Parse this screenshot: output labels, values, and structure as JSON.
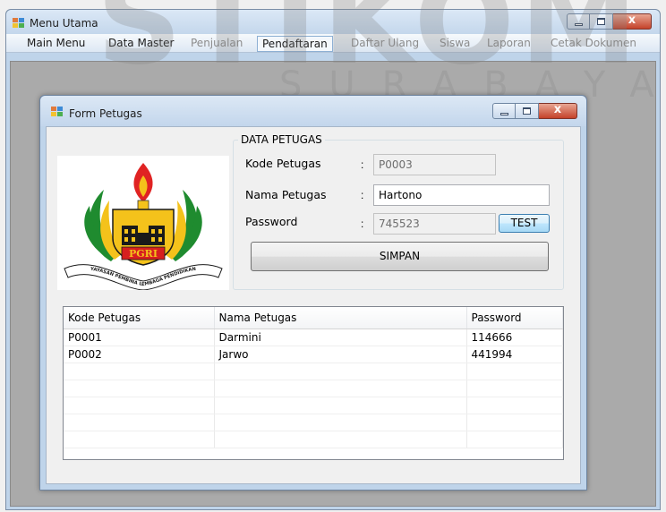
{
  "watermark": {
    "big": "STIKOM",
    "small": "SURABAYA"
  },
  "main_window": {
    "title": "Menu Utama",
    "menu": [
      {
        "label": "Main Menu",
        "state": "normal"
      },
      {
        "label": "Data Master",
        "state": "normal"
      },
      {
        "label": "Penjualan",
        "state": "disabled"
      },
      {
        "label": "Pendaftaran",
        "state": "selected"
      },
      {
        "label": "Daftar Ulang",
        "state": "disabled"
      },
      {
        "label": "Siswa",
        "state": "disabled"
      },
      {
        "label": "Laporan",
        "state": "disabled"
      },
      {
        "label": "Cetak Dokumen",
        "state": "disabled"
      }
    ],
    "buttons": {
      "close": "x"
    }
  },
  "form": {
    "title": "Form Petugas",
    "logo": {
      "name": "pgri-logo",
      "text": "PGRI",
      "ribbon": "YAYASAN PEMBINA LEMBAGA PENDIDIKAN"
    },
    "group_title": "DATA PETUGAS",
    "fields": {
      "kode": {
        "label": "Kode Petugas",
        "sep": ":",
        "value": "P0003"
      },
      "nama": {
        "label": "Nama Petugas",
        "sep": ":",
        "value": "Hartono"
      },
      "password": {
        "label": "Password",
        "sep": ":",
        "value": "745523"
      }
    },
    "test_button": "TEST",
    "save_button": "SIMPAN",
    "table": {
      "columns": [
        "Kode Petugas",
        "Nama Petugas",
        "Password"
      ],
      "rows": [
        [
          "P0001",
          "Darmini",
          "114666"
        ],
        [
          "P0002",
          "Jarwo",
          "441994"
        ],
        [
          "",
          "",
          ""
        ],
        [
          "",
          "",
          ""
        ],
        [
          "",
          "",
          ""
        ],
        [
          "",
          "",
          ""
        ],
        [
          "",
          "",
          ""
        ]
      ]
    }
  },
  "colors": {
    "chrome": "#bfd4ea",
    "client": "#aaaaaa",
    "close_red": "#c4422a"
  }
}
